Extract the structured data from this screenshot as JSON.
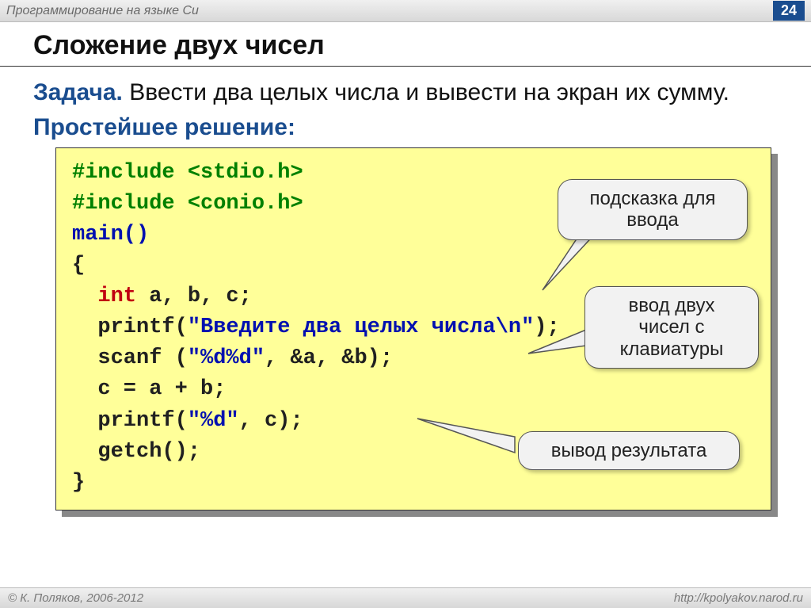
{
  "header": {
    "subject": "Программирование на языке Си",
    "page": "24"
  },
  "title": "Сложение двух чисел",
  "task_label": "Задача.",
  "task_text": " Ввести два целых числа и вывести на экран их сумму.",
  "solution_label": "Простейшее решение:",
  "code": {
    "line1a": "#include ",
    "line1b": "<stdio.h>",
    "line2a": "#include ",
    "line2b": "<conio.h>",
    "line3": "main()",
    "line4": "{",
    "line5a": "int",
    "line5b": " a, b, c;",
    "line6a": "  printf(",
    "line6b": "\"Введите два целых числа\\n\"",
    "line6c": ");",
    "line7a": "  scanf (",
    "line7b": "\"%d%d\"",
    "line7c": ", &a, &b);",
    "line8": "  c = a + b;",
    "line9a": "  printf(",
    "line9b": "\"%d\"",
    "line9c": ", c);",
    "line10": "  getch();",
    "line11": "}"
  },
  "callouts": {
    "hint": "подсказка для ввода",
    "input": "ввод двух чисел с клавиатуры",
    "output": "вывод результата"
  },
  "footer": {
    "copyright": "© К. Поляков, 2006-2012",
    "url": "http://kpolyakov.narod.ru"
  }
}
